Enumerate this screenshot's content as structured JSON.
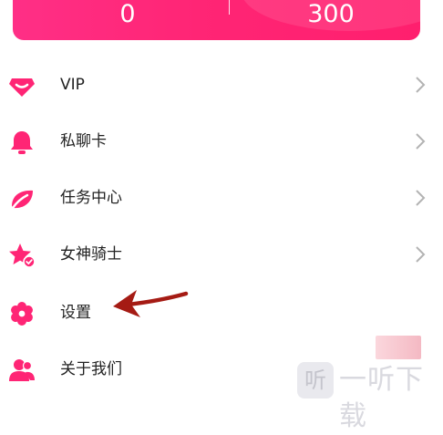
{
  "stats": {
    "left_value": "0",
    "right_value": "300"
  },
  "menu": {
    "items": [
      {
        "label": "VIP",
        "icon": "vip-diamond-icon"
      },
      {
        "label": "私聊卡",
        "icon": "bell-icon"
      },
      {
        "label": "任务中心",
        "icon": "task-leaf-icon"
      },
      {
        "label": "女神骑士",
        "icon": "star-badge-icon"
      },
      {
        "label": "设置",
        "icon": "gear-icon"
      },
      {
        "label": "关于我们",
        "icon": "users-icon"
      }
    ]
  },
  "watermark": {
    "badge": "听",
    "text": "一听下载"
  },
  "colors": {
    "accent": "#ff2575",
    "arrow": "#a51b14",
    "chevron": "#b3b3b3"
  }
}
